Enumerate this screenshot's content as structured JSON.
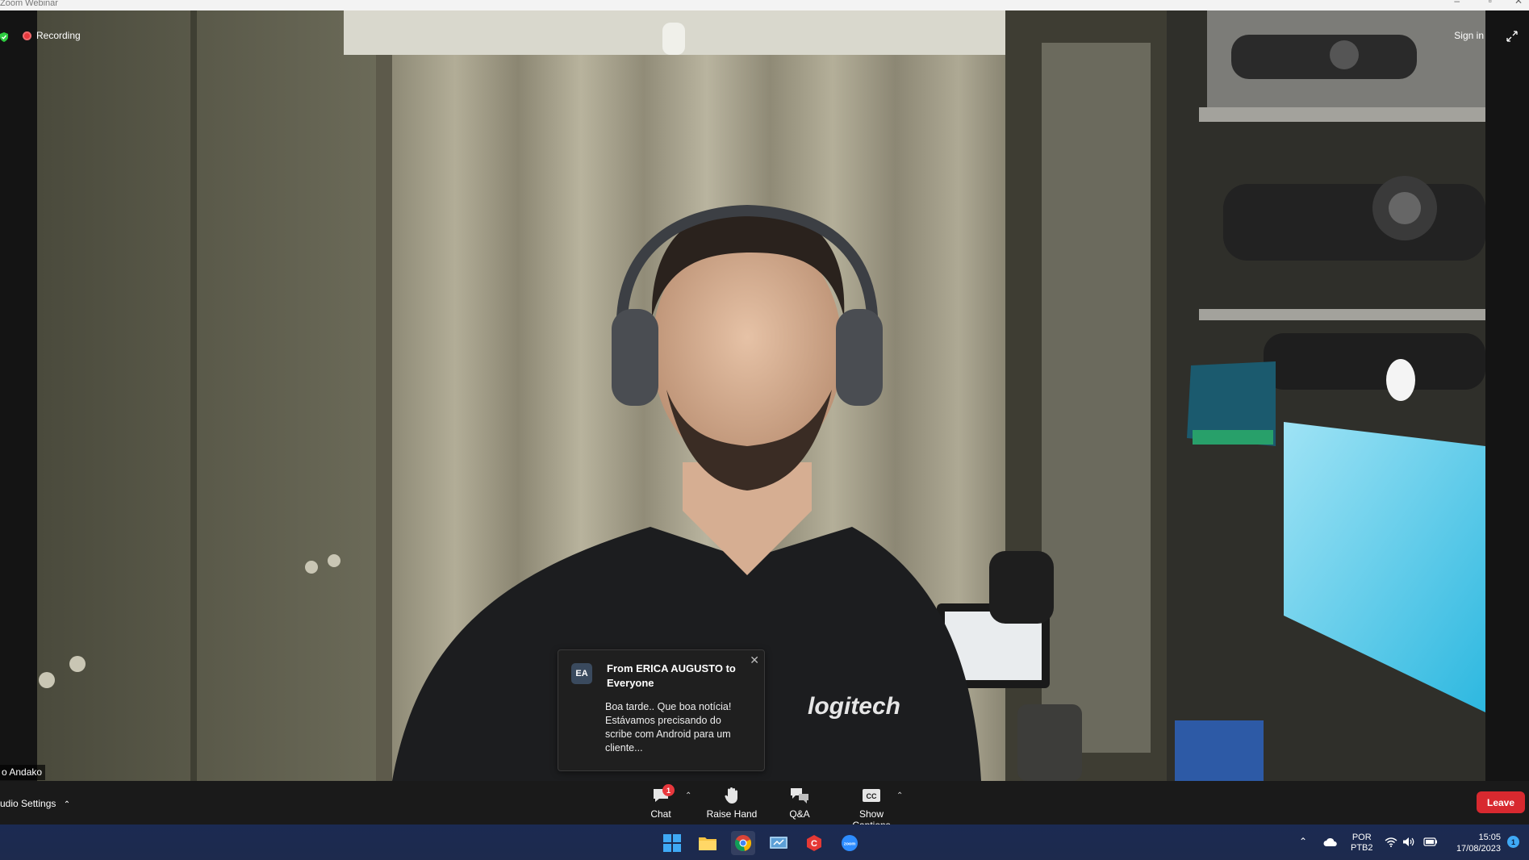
{
  "window": {
    "title": "Zoom Webinar"
  },
  "video": {
    "recording_label": "Recording",
    "sign_in_label": "Sign in",
    "speaker_name": "o Andako",
    "shirt_brand": "logitech"
  },
  "chat_notification": {
    "avatar_initials": "EA",
    "from": "From ERICA AUGUSTO to Everyone",
    "message": "Boa tarde.. Que boa notícia! Estávamos precisando do scribe com Android para um cliente..."
  },
  "controls": {
    "audio_settings_label": "udio Settings",
    "chat_label": "Chat",
    "chat_badge": "1",
    "raise_hand_label": "Raise Hand",
    "qa_label": "Q&A",
    "captions_label": "Show Captions",
    "leave_label": "Leave"
  },
  "taskbar": {
    "language": "POR",
    "layout": "PTB2",
    "time": "15:05",
    "date": "17/08/2023",
    "notification_count": "1"
  },
  "colors": {
    "leave": "#d8292f",
    "recording": "#e8383d",
    "taskbar": "#1b2a52"
  }
}
